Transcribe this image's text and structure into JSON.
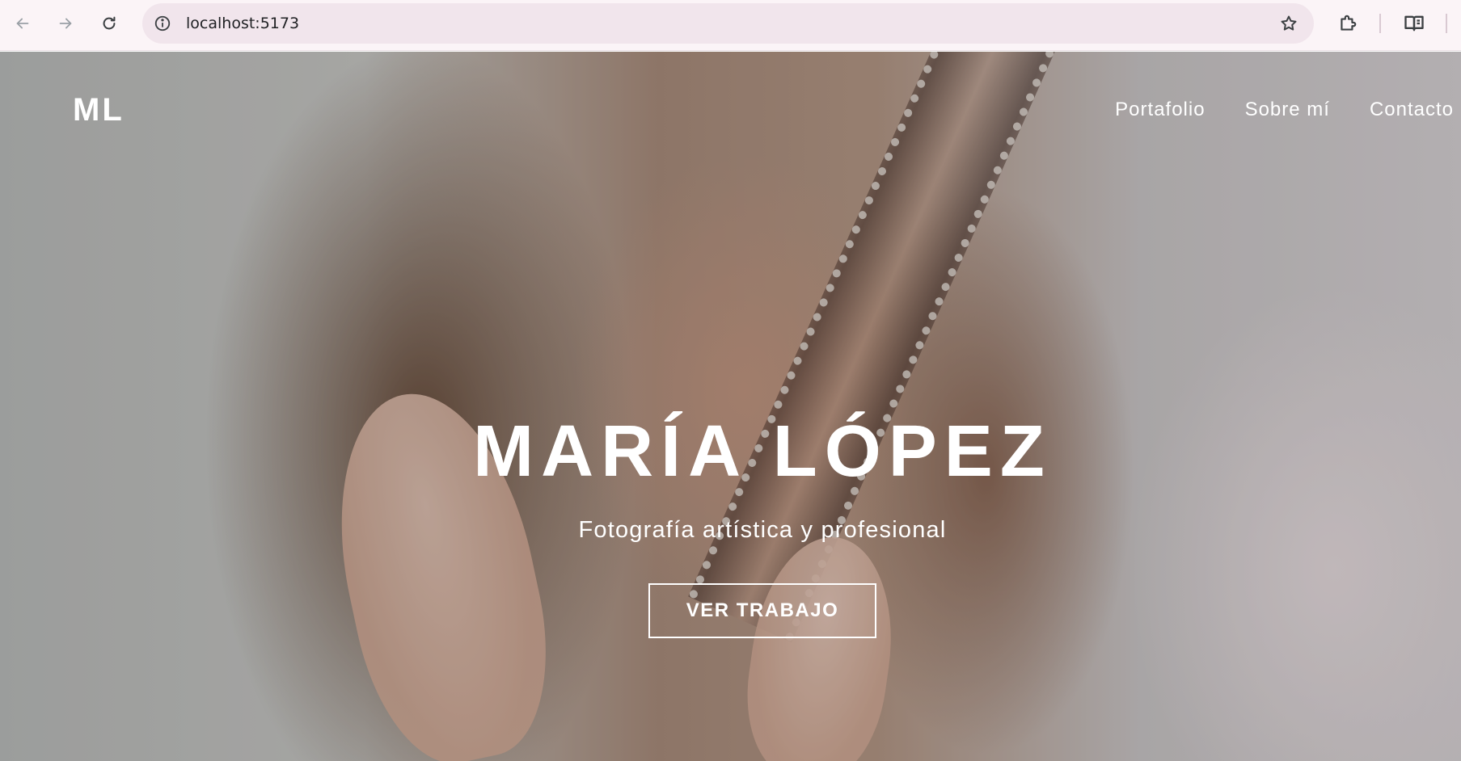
{
  "browser": {
    "url": "localhost:5173",
    "icons": {
      "back": "arrow-left-icon",
      "forward": "arrow-right-icon",
      "reload": "reload-icon",
      "site_info": "info-icon",
      "bookmark": "star-icon",
      "extensions": "puzzle-icon",
      "reading_mode": "reading-mode-icon"
    }
  },
  "site": {
    "logo": "ML",
    "nav": [
      {
        "label": "Portafolio"
      },
      {
        "label": "Sobre mí"
      },
      {
        "label": "Contacto"
      }
    ]
  },
  "hero": {
    "title": "MARÍA LÓPEZ",
    "subtitle": "Fotografía artística y profesional",
    "cta_label": "VER TRABAJO"
  },
  "colors": {
    "chrome_bg": "#fbf4f7",
    "omnibox_bg": "#f1e5ec",
    "hero_text": "#ffffff"
  }
}
